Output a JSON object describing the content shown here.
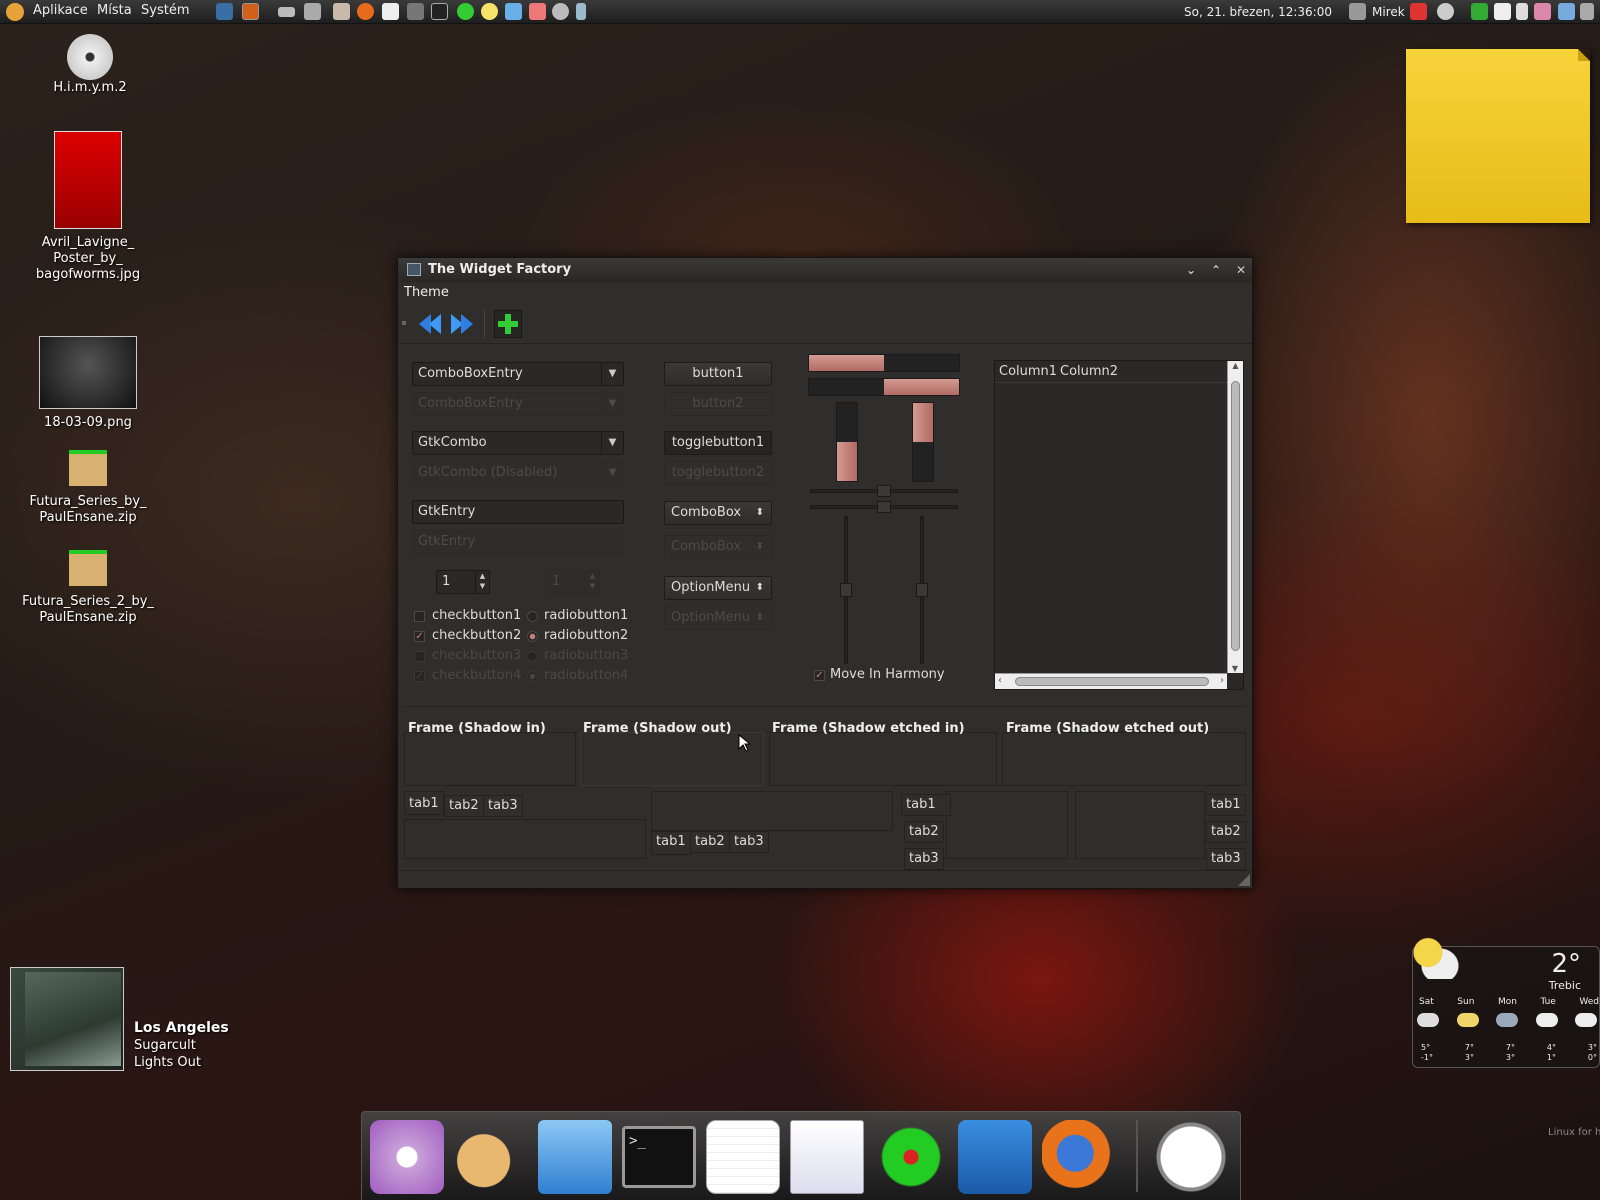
{
  "topbar": {
    "menus": [
      "Aplikace",
      "Místa",
      "Systém"
    ],
    "clock": "So, 21. březen, 12:36:00",
    "user": "Mirek"
  },
  "desktop": {
    "icons": [
      {
        "label": "H.i.m.y.m.2",
        "icon": "dvd-icon"
      },
      {
        "label": "Avril_Lavigne_\nPoster_by_\nbagofworms.jpg",
        "icon": "image-thumbnail"
      },
      {
        "label": "18-03-09.png",
        "icon": "image-thumbnail"
      },
      {
        "label": "Futura_Series_by_\nPaulEnsane.zip",
        "icon": "package-icon"
      },
      {
        "label": "Futura_Series_2_by_\nPaulEnsane.zip",
        "icon": "package-icon"
      }
    ]
  },
  "window": {
    "title": "The Widget Factory",
    "menu": "Theme",
    "combo_entry": "ComboBoxEntry",
    "combo_entry_dis": "ComboBoxEntry",
    "gtkcombo": "GtkCombo",
    "gtkcombo_dis": "GtkCombo (Disabled)",
    "entry": "GtkEntry",
    "entry_dis": "GtkEntry",
    "spin1": "1",
    "spin2": "1",
    "checks": [
      "checkbutton1",
      "checkbutton2",
      "checkbutton3",
      "checkbutton4"
    ],
    "radios": [
      "radiobutton1",
      "radiobutton2",
      "radiobutton3",
      "radiobutton4"
    ],
    "button1": "button1",
    "button2": "button2",
    "toggle1": "togglebutton1",
    "toggle2": "togglebutton2",
    "combobox": "ComboBox",
    "combobox_dis": "ComboBox",
    "optionmenu": "OptionMenu",
    "optionmenu_dis": "OptionMenu",
    "harmony": "Move In Harmony",
    "columns": [
      "Column1",
      "Column2"
    ],
    "frames": [
      "Frame (Shadow in)",
      "Frame (Shadow out)",
      "Frame (Shadow etched in)",
      "Frame (Shadow etched out)"
    ],
    "tabs": [
      "tab1",
      "tab2",
      "tab3"
    ],
    "progress": {
      "h1": 0.5,
      "h2": 0.5,
      "v1": 0.5,
      "v2": 0.5
    },
    "accent": "#c4807a"
  },
  "music": {
    "city": "Los Angeles",
    "artist": "Sugarcult",
    "album": "Lights Out"
  },
  "weather": {
    "temp": "2°",
    "city": "Trebic",
    "days": [
      "Sat",
      "Sun",
      "Mon",
      "Tue",
      "Wed"
    ],
    "highs": [
      "5°",
      "7°",
      "7°",
      "4°",
      "3°"
    ],
    "lows": [
      "-1°",
      "3°",
      "3°",
      "1°",
      "0°"
    ]
  },
  "corner_text": "Linux for h",
  "dock": {
    "items": [
      "system-settings-icon",
      "paint-icon",
      "file-cabinet-icon",
      "terminal-icon",
      "text-editor-icon",
      "screenshot-icon",
      "icq-flower-icon",
      "sketch-icon",
      "firefox-icon",
      "clock-icon"
    ]
  }
}
